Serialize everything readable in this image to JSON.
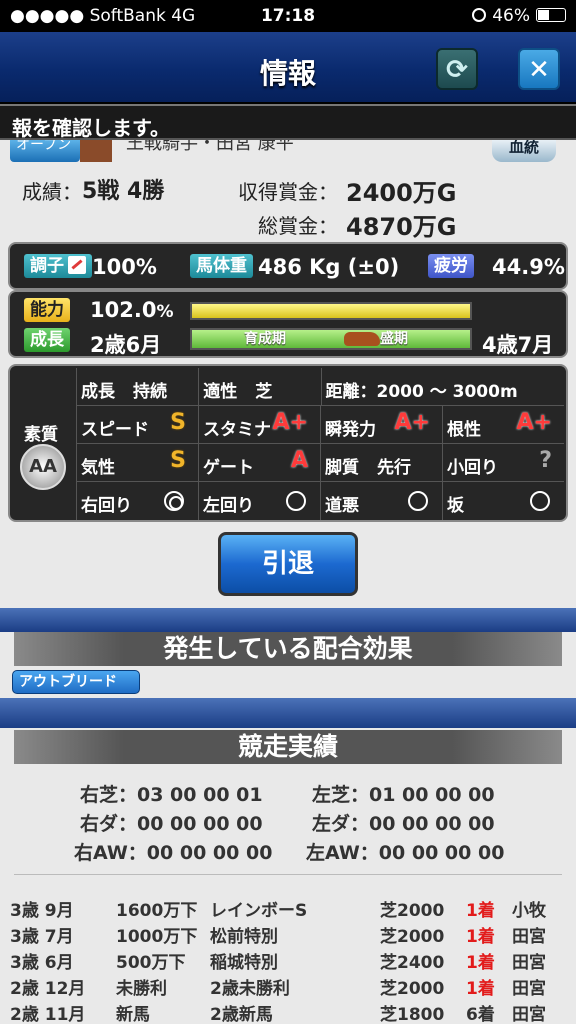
{
  "status_bar": {
    "carrier": "●●●●● SoftBank  4G",
    "time": "17:18",
    "battery": "46%",
    "battery_fill": 0.46
  },
  "header": {
    "title": "情報"
  },
  "ticker": {
    "text": "報を確認します。"
  },
  "horse": {
    "class_badge": "オープン",
    "name_partial": "王戦騎手・田宮 康平",
    "pedigree_button": "血統",
    "record_label": "成績：",
    "record_value": "5戦 4勝",
    "prize_label": "収得賞金：",
    "prize_value": "2400万G",
    "total_label": "総賞金：",
    "total_value": "4870万G"
  },
  "condition": {
    "tag": "調子",
    "value": "100%",
    "weight_tag": "馬体重",
    "weight_value": "486 Kg (±0)",
    "fatigue_tag": "疲労",
    "fatigue_value": "44.9%"
  },
  "ability": {
    "tag": "能力",
    "value_int": "102.0",
    "value_unit": "%",
    "growth_tag": "成長",
    "growth_value": "2歳6月",
    "growth_phase_1": "育成期",
    "growth_phase_2": "盛期",
    "peak_value": "4歳7月"
  },
  "aptitude": {
    "quality_label": "素質",
    "quality_grade": "AA",
    "rows": [
      [
        {
          "label": "成長",
          "value": "持続"
        },
        {
          "label": "適性",
          "value": "芝"
        },
        {
          "label": "距離：2000 〜 3000m"
        }
      ],
      [
        {
          "label": "スピード",
          "grade": "S"
        },
        {
          "label": "スタミナ",
          "grade": "A+"
        },
        {
          "label": "瞬発力",
          "grade": "A+"
        },
        {
          "label": "根性",
          "grade": "A+"
        }
      ],
      [
        {
          "label": "気性",
          "grade": "S"
        },
        {
          "label": "ゲート",
          "grade": "A"
        },
        {
          "label": "脚質",
          "value": "先行"
        },
        {
          "label": "小回り",
          "grade": "?"
        }
      ],
      [
        {
          "label": "右回り",
          "mark": "◎"
        },
        {
          "label": "左回り",
          "mark": "○"
        },
        {
          "label": "道悪",
          "mark": "○"
        },
        {
          "label": "坂",
          "mark": "○"
        }
      ]
    ]
  },
  "retire_button": "引退",
  "breeding": {
    "title": "発生している配合効果",
    "badge": "アウトブリード"
  },
  "race_record": {
    "title": "競走実績",
    "summary": [
      [
        "右芝：03 00 00 01",
        "左芝：01 00 00 00"
      ],
      [
        "右ダ：00 00 00 00",
        "左ダ：00 00 00 00"
      ],
      [
        "右AW：00 00 00 00",
        "左AW：00 00 00 00"
      ]
    ],
    "races": [
      {
        "date": "3歳 9月",
        "class": "1600万下",
        "name": "レインボーS",
        "course": "芝2000",
        "place": "1着",
        "jockey": "小牧",
        "win": true
      },
      {
        "date": "3歳 7月",
        "class": "1000万下",
        "name": "松前特別",
        "course": "芝2000",
        "place": "1着",
        "jockey": "田宮",
        "win": true
      },
      {
        "date": "3歳 6月",
        "class": "500万下",
        "name": "稲城特別",
        "course": "芝2400",
        "place": "1着",
        "jockey": "田宮",
        "win": true
      },
      {
        "date": "2歳 12月",
        "class": "未勝利",
        "name": "2歳未勝利",
        "course": "芝2000",
        "place": "1着",
        "jockey": "田宮",
        "win": true
      },
      {
        "date": "2歳 11月",
        "class": "新馬",
        "name": "2歳新馬",
        "course": "芝1800",
        "place": "6着",
        "jockey": "田宮",
        "win": false
      }
    ]
  }
}
